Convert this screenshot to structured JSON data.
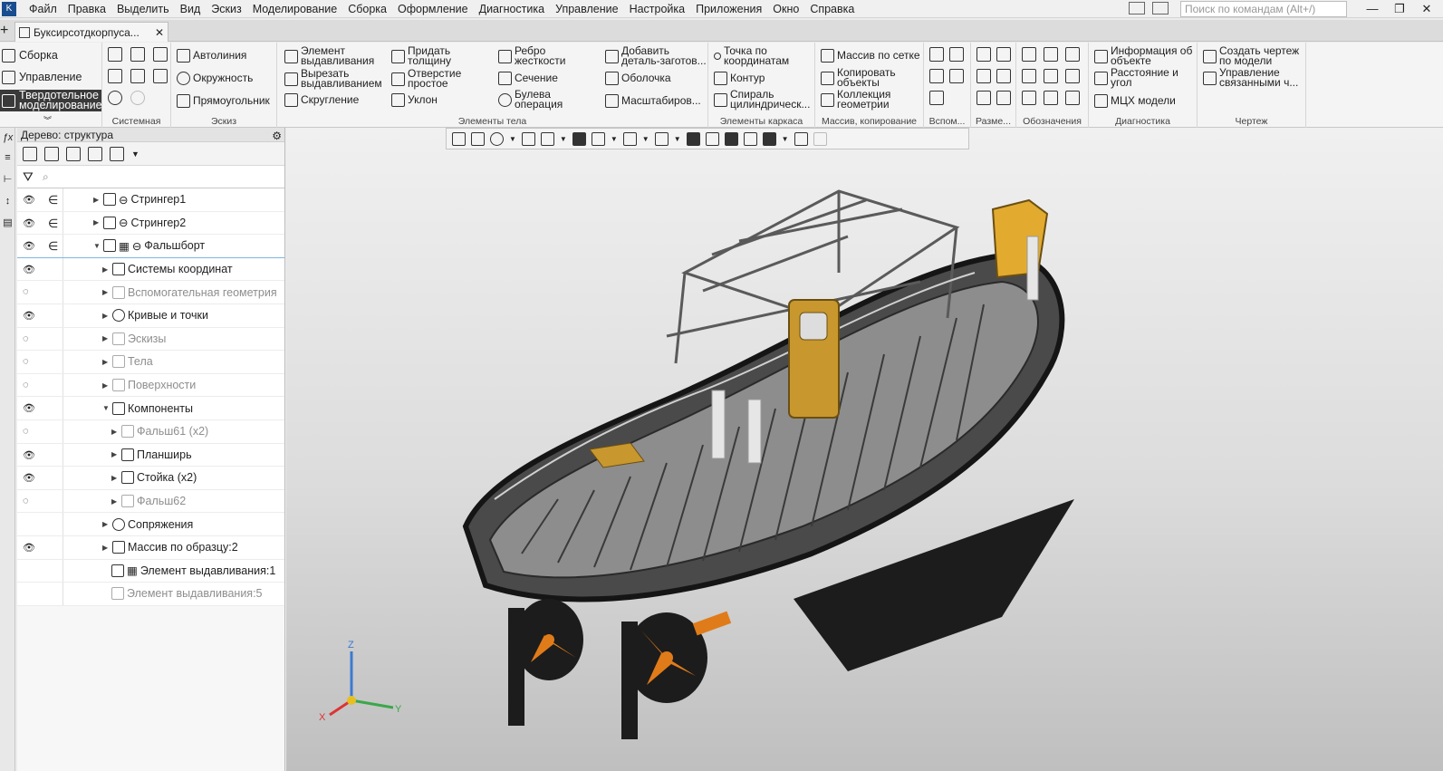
{
  "menubar": {
    "items": [
      "Файл",
      "Правка",
      "Выделить",
      "Вид",
      "Эскиз",
      "Моделирование",
      "Сборка",
      "Оформление",
      "Диагностика",
      "Управление",
      "Настройка",
      "Приложения",
      "Окно",
      "Справка"
    ],
    "search_placeholder": "Поиск по командам (Alt+/)",
    "minimize": "—",
    "maximize": "❐",
    "close": "✕"
  },
  "tabs": {
    "add": "+",
    "document": "Буксирсотдкорпуса...",
    "close": "✕"
  },
  "ribbon": {
    "modes": [
      "Сборка",
      "Управление",
      "Твердотельное\nмоделирование"
    ],
    "groups": {
      "system": "Системная",
      "sketch": "Эскиз",
      "body": "Элементы тела",
      "frame": "Элементы каркаса",
      "array": "Массив, копирование",
      "aux": "Вспом...",
      "dims": "Разме...",
      "notation": "Обозначения",
      "diag": "Диагностика",
      "drawing": "Чертеж"
    },
    "sketch_items": [
      "Автолиния",
      "Окружность",
      "Прямоугольник"
    ],
    "body_col1": [
      "Элемент\nвыдавливания",
      "Вырезать\nвыдавливанием",
      "Скругление"
    ],
    "body_col2": [
      "Придать\nтолщину",
      "Отверстие\nпростое",
      "Уклон"
    ],
    "body_col3": [
      "Ребро\nжесткости",
      "Сечение",
      "Булева\nоперация"
    ],
    "body_col4": [
      "Добавить\nдеталь-заготов...",
      "Оболочка",
      "Масштабиров..."
    ],
    "frame_items": [
      "Точка по\nкоординатам",
      "Контур",
      "Спираль\nцилиндрическ..."
    ],
    "array_items": [
      "Массив по сетке",
      "Копировать\nобъекты",
      "Коллекция\nгеометрии"
    ],
    "diag_items": [
      "Информация об\nобъекте",
      "Расстояние и\nугол",
      "МЦХ модели"
    ],
    "drawing_items": [
      "Создать чертеж\nпо модели",
      "Управление\nсвязанными ч..."
    ]
  },
  "tree": {
    "title": "Дерево: структура",
    "filter_placeholder": "⌕",
    "rows": [
      {
        "label": "Стрингер1",
        "eye": "👁",
        "link": "∈"
      },
      {
        "label": "Стрингер2",
        "eye": "👁",
        "link": "∈"
      },
      {
        "label": "Фальшборт",
        "eye": "👁",
        "link": "∈"
      },
      {
        "label": "Системы координат",
        "eye": "👁",
        "link": ""
      },
      {
        "label": "Вспомогательная геометрия",
        "eye": "◌",
        "link": ""
      },
      {
        "label": "Кривые и точки",
        "eye": "👁",
        "link": ""
      },
      {
        "label": "Эскизы",
        "eye": "◌",
        "link": ""
      },
      {
        "label": "Тела",
        "eye": "◌",
        "link": ""
      },
      {
        "label": "Поверхности",
        "eye": "◌",
        "link": ""
      },
      {
        "label": "Компоненты",
        "eye": "👁",
        "link": ""
      },
      {
        "label": "Фальш61 (x2)",
        "eye": "◌",
        "link": ""
      },
      {
        "label": "Планширь",
        "eye": "👁",
        "link": ""
      },
      {
        "label": "Стойка (x2)",
        "eye": "👁",
        "link": ""
      },
      {
        "label": "Фальш62",
        "eye": "◌",
        "link": ""
      },
      {
        "label": "Сопряжения",
        "eye": "",
        "link": ""
      },
      {
        "label": "Массив по образцу:2",
        "eye": "👁",
        "link": ""
      },
      {
        "label": "Элемент выдавливания:1",
        "eye": "",
        "link": ""
      },
      {
        "label": "Элемент выдавливания:5",
        "eye": "",
        "link": ""
      }
    ]
  },
  "axes": {
    "x": "X",
    "y": "Y",
    "z": "Z"
  },
  "colors": {
    "accent": "#1a4d8f",
    "hull": "#2b2b2b",
    "door": "#c8972e",
    "propeller": "#e07b1a"
  }
}
